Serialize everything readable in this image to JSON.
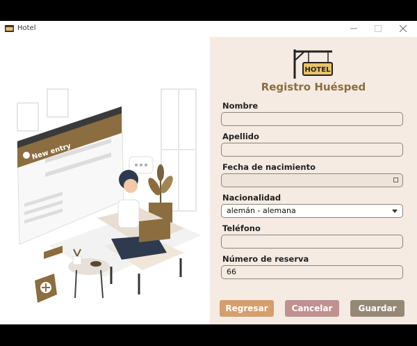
{
  "window": {
    "title": "Hotel"
  },
  "form": {
    "logo_text": "HOTEL",
    "title": "Registro Huésped",
    "nombre_label": "Nombre",
    "nombre_value": "",
    "apellido_label": "Apellido",
    "apellido_value": "",
    "fecha_label": "Fecha de nacimiento",
    "fecha_value": "",
    "nacionalidad_label": "Nacionalidad",
    "nacionalidad_value": "alemán - alemana",
    "telefono_label": "Teléfono",
    "telefono_value": "",
    "reserva_label": "Número de reserva",
    "reserva_value": "66"
  },
  "buttons": {
    "regresar": "Regresar",
    "cancelar": "Cancelar",
    "guardar": "Guardar"
  },
  "illustration": {
    "new_entry": "New entry"
  },
  "colors": {
    "regresar": "#d69e6c",
    "cancelar": "#c09191",
    "guardar": "#958877",
    "accent": "#8a6e3f"
  }
}
